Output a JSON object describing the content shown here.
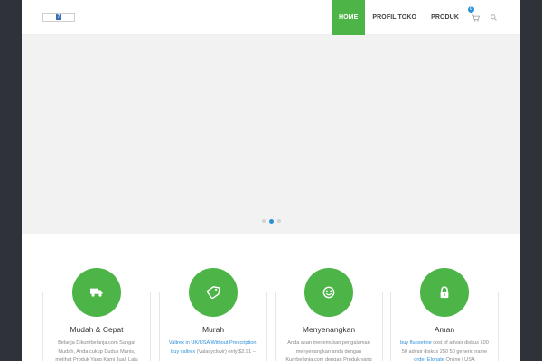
{
  "header": {
    "logo_glyph": "7",
    "nav": [
      "HOME",
      "PROFIL TOKO",
      "PRODUK"
    ],
    "active_nav": "HOME",
    "cart_count": "0"
  },
  "slider": {
    "active_index": 1,
    "dot_count": 3
  },
  "features": [
    {
      "title": "Mudah & Cepat",
      "icon": "truck-icon",
      "text_parts": [
        {
          "text": "Belanja Dikurirbelanja.com Sangat Mudah, Anda cukup Duduk Manis, melihat Produk Yang Kami Jual, Lalu"
        }
      ]
    },
    {
      "title": "Murah",
      "icon": "tag-icon",
      "text_parts": [
        {
          "text": "Valtrex in UK/USA Without Prescription",
          "link": true
        },
        {
          "text": ", "
        },
        {
          "text": "buy valtrex",
          "link": true
        },
        {
          "text": " (Valacyclovir) only $2.91 –"
        }
      ]
    },
    {
      "title": "Menyenangkan",
      "icon": "smile-icon",
      "text_parts": [
        {
          "text": "Anda akan menemukan pengalaman menyenangkan anda dengan Kurirbelanja.com dengan Produk yang"
        }
      ]
    },
    {
      "title": "Aman",
      "icon": "lock-icon",
      "text_parts": [
        {
          "text": "buy fluoxetine",
          "link": true
        },
        {
          "text": " cost of advair diskus 100 50 advair diskus 250 50 generic name "
        },
        {
          "text": "order Elonate",
          "link": true
        },
        {
          "text": " Online | USA"
        }
      ]
    }
  ],
  "colors": {
    "accent": "#4db547",
    "link": "#2b8fd8",
    "frame": "#2f3238",
    "slider_bg": "#f2f2f2"
  }
}
